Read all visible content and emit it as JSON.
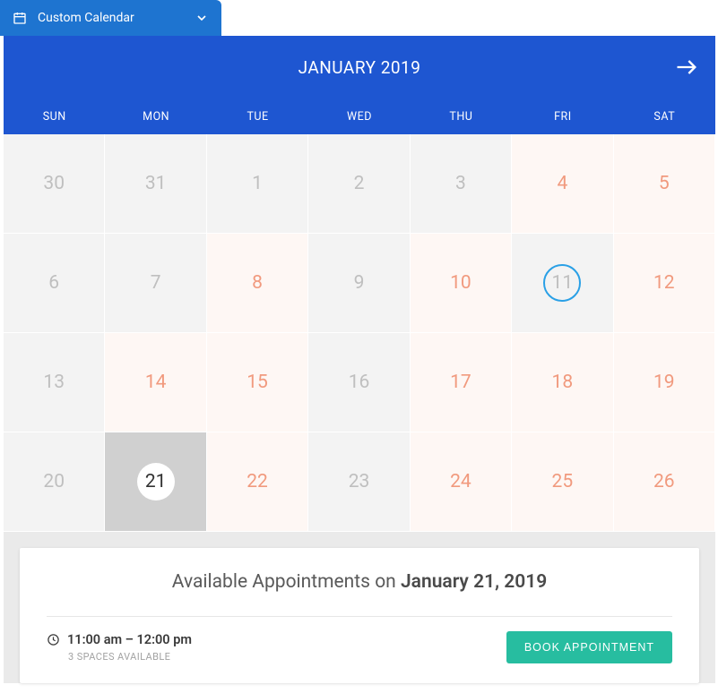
{
  "dropdown": {
    "label": "Custom Calendar"
  },
  "header": {
    "month_label": "JANUARY 2019"
  },
  "dow": [
    "SUN",
    "MON",
    "TUE",
    "WED",
    "THU",
    "FRI",
    "SAT"
  ],
  "weeks": [
    [
      {
        "n": "30",
        "state": "unavailable"
      },
      {
        "n": "31",
        "state": "unavailable"
      },
      {
        "n": "1",
        "state": "unavailable"
      },
      {
        "n": "2",
        "state": "unavailable"
      },
      {
        "n": "3",
        "state": "unavailable"
      },
      {
        "n": "4",
        "state": "available"
      },
      {
        "n": "5",
        "state": "available"
      }
    ],
    [
      {
        "n": "6",
        "state": "unavailable"
      },
      {
        "n": "7",
        "state": "unavailable"
      },
      {
        "n": "8",
        "state": "available"
      },
      {
        "n": "9",
        "state": "unavailable"
      },
      {
        "n": "10",
        "state": "available"
      },
      {
        "n": "11",
        "state": "unavailable",
        "today": true
      },
      {
        "n": "12",
        "state": "available"
      }
    ],
    [
      {
        "n": "13",
        "state": "unavailable"
      },
      {
        "n": "14",
        "state": "available"
      },
      {
        "n": "15",
        "state": "available"
      },
      {
        "n": "16",
        "state": "unavailable"
      },
      {
        "n": "17",
        "state": "available"
      },
      {
        "n": "18",
        "state": "available"
      },
      {
        "n": "19",
        "state": "available"
      }
    ],
    [
      {
        "n": "20",
        "state": "unavailable"
      },
      {
        "n": "21",
        "state": "selected"
      },
      {
        "n": "22",
        "state": "available"
      },
      {
        "n": "23",
        "state": "unavailable"
      },
      {
        "n": "24",
        "state": "available"
      },
      {
        "n": "25",
        "state": "available"
      },
      {
        "n": "26",
        "state": "available"
      }
    ]
  ],
  "panel": {
    "title_prefix": "Available Appointments on ",
    "title_date": "January 21, 2019",
    "slot_time": "11:00 am – 12:00 pm",
    "slot_spaces": "3 SPACES AVAILABLE",
    "book_label": "BOOK APPOINTMENT"
  }
}
